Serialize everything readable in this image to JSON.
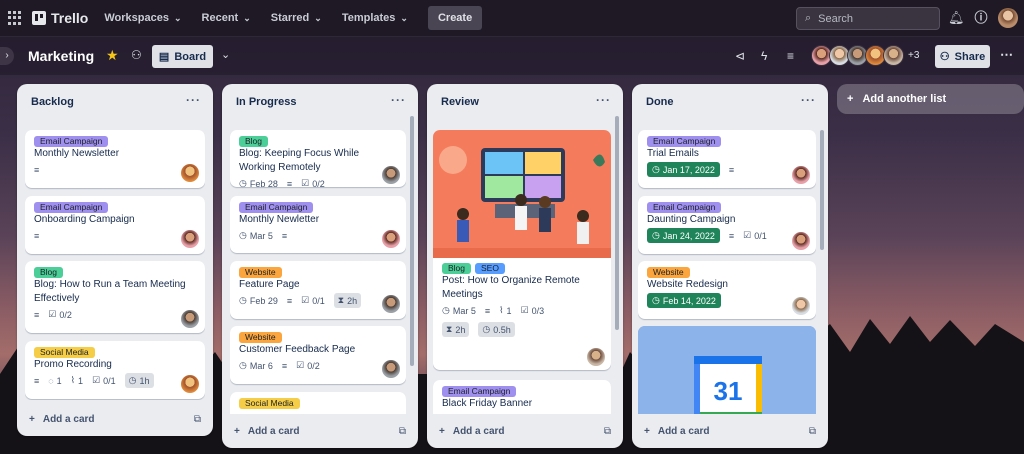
{
  "nav": {
    "logo": "Trello",
    "items": [
      "Workspaces",
      "Recent",
      "Starred",
      "Templates"
    ],
    "create": "Create",
    "search_placeholder": "Search"
  },
  "board": {
    "title": "Marketing",
    "view": "Board",
    "extra_members": "+3",
    "share": "Share"
  },
  "lists": [
    {
      "title": "Backlog",
      "add_card": "Add a card",
      "cards": [
        {
          "labels": [
            {
              "text": "Email Campaign",
              "color": "purple"
            }
          ],
          "title": "Monthly Newsletter"
        },
        {
          "labels": [
            {
              "text": "Email Campaign",
              "color": "purple"
            }
          ],
          "title": "Onboarding Campaign"
        },
        {
          "labels": [
            {
              "text": "Blog",
              "color": "green"
            }
          ],
          "title": "Blog: How to Run a Team Meeting Effectively",
          "checklist": "0/2"
        },
        {
          "labels": [
            {
              "text": "Social Media",
              "color": "yellow"
            }
          ],
          "title": "Promo Recording",
          "comments": "1",
          "attachments": "1",
          "checklist": "0/1",
          "timer": "1h"
        }
      ]
    },
    {
      "title": "In Progress",
      "add_card": "Add a card",
      "cards": [
        {
          "labels": [
            {
              "text": "Blog",
              "color": "green"
            }
          ],
          "title": "Blog: Keeping Focus While Working Remotely",
          "date": "Feb 28",
          "checklist": "0/2"
        },
        {
          "labels": [
            {
              "text": "Email Campaign",
              "color": "purple"
            }
          ],
          "title": "Monthly Newletter",
          "date": "Mar 5"
        },
        {
          "labels": [
            {
              "text": "Website",
              "color": "orange"
            }
          ],
          "title": "Feature Page",
          "date": "Feb 29",
          "checklist": "0/1",
          "timer": "2h"
        },
        {
          "labels": [
            {
              "text": "Website",
              "color": "orange"
            }
          ],
          "title": "Customer Feedback Page",
          "date": "Mar 6",
          "checklist": "0/2"
        },
        {
          "labels": [
            {
              "text": "Social Media",
              "color": "yellow"
            }
          ],
          "title": ""
        }
      ]
    },
    {
      "title": "Review",
      "add_card": "Add a card",
      "cards": [
        {
          "labels": [
            {
              "text": "Blog",
              "color": "green"
            },
            {
              "text": "SEO",
              "color": "blue"
            }
          ],
          "title": "Post: How to Organize Remote Meetings",
          "date": "Mar 5",
          "attachments": "1",
          "checklist": "0/3",
          "timer": "2h",
          "timer2": "0.5h"
        },
        {
          "labels": [
            {
              "text": "Email Campaign",
              "color": "purple"
            }
          ],
          "title": "Black Friday Banner"
        }
      ]
    },
    {
      "title": "Done",
      "add_card": "Add a card",
      "cards": [
        {
          "labels": [
            {
              "text": "Email Campaign",
              "color": "purple"
            }
          ],
          "title": "Trial Emails",
          "due": "Jan 17, 2022"
        },
        {
          "labels": [
            {
              "text": "Email Campaign",
              "color": "purple"
            }
          ],
          "title": "Daunting Campaign",
          "due": "Jan 24, 2022",
          "checklist": "0/1"
        },
        {
          "labels": [
            {
              "text": "Website",
              "color": "orange"
            }
          ],
          "title": "Website Redesign",
          "due": "Feb 14, 2022"
        },
        {
          "calendar_day": "31"
        }
      ]
    }
  ],
  "add_list": "Add another list",
  "colors": {
    "purple": "#9f8fef",
    "green": "#4bce97",
    "orange": "#faa53d",
    "yellow": "#f5cd47",
    "blue": "#579dff",
    "due_complete": "#1f845a"
  }
}
